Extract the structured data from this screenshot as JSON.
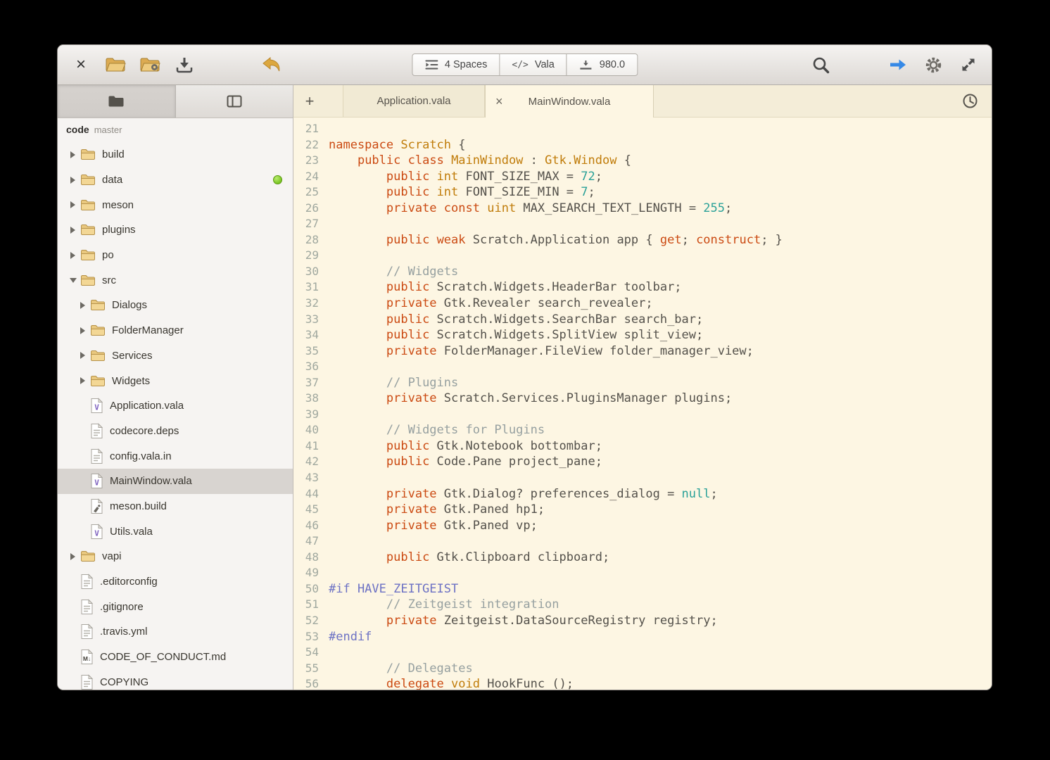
{
  "theme": {
    "editor_bg": "#fdf6e3",
    "keyword_color": "#cb4a12",
    "type_color": "#c07c0a",
    "number_color": "#2aa198",
    "comment_color": "#96a0a0",
    "preprocessor_color": "#6c71c4",
    "accent_blue": "#3689e6",
    "folder_color": "#e9c87f",
    "status_green": "#76c21e"
  },
  "headerbar": {
    "close_glyph": "×",
    "center_buttons": [
      {
        "icon": "indent",
        "label": "4 Spaces"
      },
      {
        "icon": "code",
        "glyph": "</>",
        "label": "Vala"
      },
      {
        "icon": "line-width",
        "label": "980.0"
      }
    ]
  },
  "sidebar": {
    "project": {
      "name": "code",
      "branch": "master"
    },
    "items": [
      {
        "label": "build",
        "icon": "folder",
        "level": 0,
        "disclosure": "collapsed"
      },
      {
        "label": "data",
        "icon": "folder",
        "level": 0,
        "disclosure": "collapsed",
        "badge": "green-dot"
      },
      {
        "label": "meson",
        "icon": "folder",
        "level": 0,
        "disclosure": "collapsed"
      },
      {
        "label": "plugins",
        "icon": "folder",
        "level": 0,
        "disclosure": "collapsed"
      },
      {
        "label": "po",
        "icon": "folder",
        "level": 0,
        "disclosure": "collapsed"
      },
      {
        "label": "src",
        "icon": "folder",
        "level": 0,
        "disclosure": "expanded"
      },
      {
        "label": "Dialogs",
        "icon": "folder",
        "level": 1,
        "disclosure": "collapsed"
      },
      {
        "label": "FolderManager",
        "icon": "folder",
        "level": 1,
        "disclosure": "collapsed"
      },
      {
        "label": "Services",
        "icon": "folder",
        "level": 1,
        "disclosure": "collapsed"
      },
      {
        "label": "Widgets",
        "icon": "folder",
        "level": 1,
        "disclosure": "collapsed"
      },
      {
        "label": "Application.vala",
        "icon": "vala-file",
        "level": 1
      },
      {
        "label": "codecore.deps",
        "icon": "text-file",
        "level": 1
      },
      {
        "label": "config.vala.in",
        "icon": "text-file",
        "level": 1
      },
      {
        "label": "MainWindow.vala",
        "icon": "vala-file",
        "level": 1,
        "selected": true
      },
      {
        "label": "meson.build",
        "icon": "build-file",
        "level": 1
      },
      {
        "label": "Utils.vala",
        "icon": "vala-file",
        "level": 1
      },
      {
        "label": "vapi",
        "icon": "folder",
        "level": 0,
        "disclosure": "collapsed"
      },
      {
        "label": ".editorconfig",
        "icon": "text-file",
        "level": 0
      },
      {
        "label": ".gitignore",
        "icon": "text-file",
        "level": 0
      },
      {
        "label": ".travis.yml",
        "icon": "text-file",
        "level": 0
      },
      {
        "label": "CODE_OF_CONDUCT.md",
        "icon": "markdown-file",
        "level": 0
      },
      {
        "label": "COPYING",
        "icon": "text-file",
        "level": 0
      }
    ]
  },
  "tabbar": {
    "new_tab_glyph": "+",
    "close_glyph": "×",
    "tabs": [
      {
        "label": "Application.vala",
        "active": false,
        "closable": false
      },
      {
        "label": "MainWindow.vala",
        "active": true,
        "closable": true
      }
    ]
  },
  "editor": {
    "first_line": 21,
    "lines": [
      {
        "n": 21,
        "t": []
      },
      {
        "n": 22,
        "t": [
          [
            "k",
            "namespace"
          ],
          [
            "d",
            " "
          ],
          [
            "t",
            "Scratch"
          ],
          [
            "d",
            " {"
          ]
        ]
      },
      {
        "n": 23,
        "t": [
          [
            "d",
            "    "
          ],
          [
            "k",
            "public"
          ],
          [
            "d",
            " "
          ],
          [
            "k",
            "class"
          ],
          [
            "d",
            " "
          ],
          [
            "t",
            "MainWindow"
          ],
          [
            "d",
            " : "
          ],
          [
            "t",
            "Gtk.Window"
          ],
          [
            "d",
            " {"
          ]
        ]
      },
      {
        "n": 24,
        "t": [
          [
            "d",
            "        "
          ],
          [
            "k",
            "public"
          ],
          [
            "d",
            " "
          ],
          [
            "t",
            "int"
          ],
          [
            "d",
            " FONT_SIZE_MAX = "
          ],
          [
            "n",
            "72"
          ],
          [
            "d",
            ";"
          ]
        ]
      },
      {
        "n": 25,
        "t": [
          [
            "d",
            "        "
          ],
          [
            "k",
            "public"
          ],
          [
            "d",
            " "
          ],
          [
            "t",
            "int"
          ],
          [
            "d",
            " FONT_SIZE_MIN = "
          ],
          [
            "n",
            "7"
          ],
          [
            "d",
            ";"
          ]
        ]
      },
      {
        "n": 26,
        "t": [
          [
            "d",
            "        "
          ],
          [
            "k",
            "private"
          ],
          [
            "d",
            " "
          ],
          [
            "k",
            "const"
          ],
          [
            "d",
            " "
          ],
          [
            "t",
            "uint"
          ],
          [
            "d",
            " MAX_SEARCH_TEXT_LENGTH = "
          ],
          [
            "n",
            "255"
          ],
          [
            "d",
            ";"
          ]
        ]
      },
      {
        "n": 27,
        "t": []
      },
      {
        "n": 28,
        "t": [
          [
            "d",
            "        "
          ],
          [
            "k",
            "public"
          ],
          [
            "d",
            " "
          ],
          [
            "k",
            "weak"
          ],
          [
            "d",
            " Scratch.Application app { "
          ],
          [
            "k",
            "get"
          ],
          [
            "d",
            "; "
          ],
          [
            "k",
            "construct"
          ],
          [
            "d",
            "; }"
          ]
        ]
      },
      {
        "n": 29,
        "t": []
      },
      {
        "n": 30,
        "t": [
          [
            "d",
            "        "
          ],
          [
            "c",
            "// Widgets"
          ]
        ]
      },
      {
        "n": 31,
        "t": [
          [
            "d",
            "        "
          ],
          [
            "k",
            "public"
          ],
          [
            "d",
            " Scratch.Widgets.HeaderBar toolbar;"
          ]
        ]
      },
      {
        "n": 32,
        "t": [
          [
            "d",
            "        "
          ],
          [
            "k",
            "private"
          ],
          [
            "d",
            " Gtk.Revealer search_revealer;"
          ]
        ]
      },
      {
        "n": 33,
        "t": [
          [
            "d",
            "        "
          ],
          [
            "k",
            "public"
          ],
          [
            "d",
            " Scratch.Widgets.SearchBar search_bar;"
          ]
        ]
      },
      {
        "n": 34,
        "t": [
          [
            "d",
            "        "
          ],
          [
            "k",
            "public"
          ],
          [
            "d",
            " Scratch.Widgets.SplitView split_view;"
          ]
        ]
      },
      {
        "n": 35,
        "t": [
          [
            "d",
            "        "
          ],
          [
            "k",
            "private"
          ],
          [
            "d",
            " FolderManager.FileView folder_manager_view;"
          ]
        ]
      },
      {
        "n": 36,
        "t": []
      },
      {
        "n": 37,
        "t": [
          [
            "d",
            "        "
          ],
          [
            "c",
            "// Plugins"
          ]
        ]
      },
      {
        "n": 38,
        "t": [
          [
            "d",
            "        "
          ],
          [
            "k",
            "private"
          ],
          [
            "d",
            " Scratch.Services.PluginsManager plugins;"
          ]
        ]
      },
      {
        "n": 39,
        "t": []
      },
      {
        "n": 40,
        "t": [
          [
            "d",
            "        "
          ],
          [
            "c",
            "// Widgets for Plugins"
          ]
        ]
      },
      {
        "n": 41,
        "t": [
          [
            "d",
            "        "
          ],
          [
            "k",
            "public"
          ],
          [
            "d",
            " Gtk.Notebook bottombar;"
          ]
        ]
      },
      {
        "n": 42,
        "t": [
          [
            "d",
            "        "
          ],
          [
            "k",
            "public"
          ],
          [
            "d",
            " Code.Pane project_pane;"
          ]
        ]
      },
      {
        "n": 43,
        "t": []
      },
      {
        "n": 44,
        "t": [
          [
            "d",
            "        "
          ],
          [
            "k",
            "private"
          ],
          [
            "d",
            " Gtk.Dialog? preferences_dialog = "
          ],
          [
            "n",
            "null"
          ],
          [
            "d",
            ";"
          ]
        ]
      },
      {
        "n": 45,
        "t": [
          [
            "d",
            "        "
          ],
          [
            "k",
            "private"
          ],
          [
            "d",
            " Gtk.Paned hp1;"
          ]
        ]
      },
      {
        "n": 46,
        "t": [
          [
            "d",
            "        "
          ],
          [
            "k",
            "private"
          ],
          [
            "d",
            " Gtk.Paned vp;"
          ]
        ]
      },
      {
        "n": 47,
        "t": []
      },
      {
        "n": 48,
        "t": [
          [
            "d",
            "        "
          ],
          [
            "k",
            "public"
          ],
          [
            "d",
            " Gtk.Clipboard clipboard;"
          ]
        ]
      },
      {
        "n": 49,
        "t": []
      },
      {
        "n": 50,
        "t": [
          [
            "p",
            "#if HAVE_ZEITGEIST"
          ]
        ]
      },
      {
        "n": 51,
        "t": [
          [
            "d",
            "        "
          ],
          [
            "c",
            "// Zeitgeist integration"
          ]
        ]
      },
      {
        "n": 52,
        "t": [
          [
            "d",
            "        "
          ],
          [
            "k",
            "private"
          ],
          [
            "d",
            " Zeitgeist.DataSourceRegistry registry;"
          ]
        ]
      },
      {
        "n": 53,
        "t": [
          [
            "p",
            "#endif"
          ]
        ]
      },
      {
        "n": 54,
        "t": []
      },
      {
        "n": 55,
        "t": [
          [
            "d",
            "        "
          ],
          [
            "c",
            "// Delegates"
          ]
        ]
      },
      {
        "n": 56,
        "t": [
          [
            "d",
            "        "
          ],
          [
            "k",
            "delegate"
          ],
          [
            "d",
            " "
          ],
          [
            "t",
            "void"
          ],
          [
            "d",
            " HookFunc ();"
          ]
        ]
      }
    ]
  }
}
